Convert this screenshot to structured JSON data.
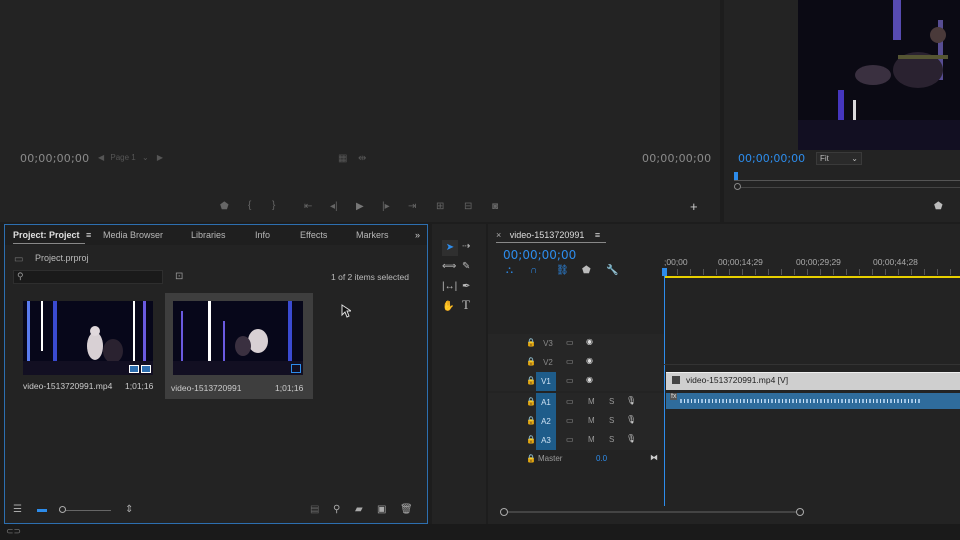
{
  "source_monitor": {
    "timecode_left": "00;00;00;00",
    "page_label": "Page 1",
    "timecode_right": "00;00;00;00"
  },
  "program_monitor": {
    "timecode": "00;00;00;00",
    "fit_label": "Fit"
  },
  "project_panel": {
    "tabs": [
      "Project: Project",
      "Media Browser",
      "Libraries",
      "Info",
      "Effects",
      "Markers"
    ],
    "project_file": "Project.prproj",
    "items_selected": "1 of 2 items selected",
    "items": [
      {
        "name": "video-1513720991.mp4",
        "duration": "1;01;16"
      },
      {
        "name": "video-1513720991",
        "duration": "1;01;16"
      }
    ]
  },
  "timeline": {
    "tab_label": "video-1513720991",
    "timecode": "00;00;00;00",
    "ruler": [
      ";00;00",
      "00;00;14;29",
      "00;00;29;29",
      "00;00;44;28"
    ],
    "video_tracks": [
      "V3",
      "V2",
      "V1"
    ],
    "audio_tracks": [
      "A1",
      "A2",
      "A3"
    ],
    "source_v1": "V1",
    "source_a1": "A1",
    "source_a2": "A2",
    "source_a3": "A3",
    "master_label": "Master",
    "master_value": "0.0",
    "clip_label": "video-1513720991.mp4 [V]",
    "mute_label": "M",
    "solo_label": "S",
    "fx_label": "fx"
  },
  "colors": {
    "accent_blue": "#2d8ceb",
    "playhead_yellow": "#e8d000",
    "video_clip": "#cfcfcf",
    "audio_clip": "#2f6c9c"
  }
}
